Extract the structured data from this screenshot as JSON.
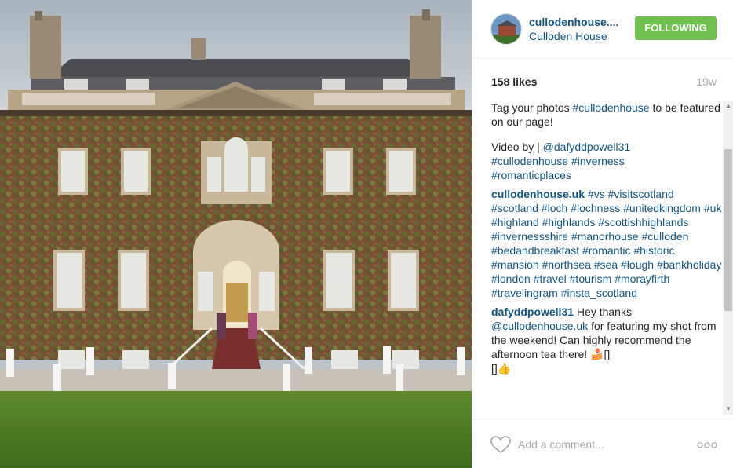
{
  "post": {
    "username": "cullodenhouse....",
    "location": "Culloden House",
    "follow_label": "FOLLOWING",
    "likes": "158 likes",
    "time_ago": "19w"
  },
  "caption": {
    "line1_text": "Tag your photos ",
    "line1_tag": "#cullodenhouse",
    "line1_rest": " to be featured on our page!",
    "video_prefix": "Video by | ",
    "video_mention": "@dafyddpowell31",
    "tag_cullodenhouse": "#cullodenhouse",
    "tag_inverness": "#inverness",
    "tag_romanticplaces": "#romanticplaces"
  },
  "comments": [
    {
      "author": "cullodenhouse.uk",
      "tags": [
        "#vs",
        "#visitscotland",
        "#scotland",
        "#loch",
        "#lochness",
        "#unitedkingdom",
        "#uk",
        "#highland",
        "#highlands",
        "#scottishhighlands",
        "#invernessshire",
        "#manorhouse",
        "#culloden",
        "#bedandbreakfast",
        "#romantic",
        "#historic",
        "#mansion",
        "#northsea",
        "#sea",
        "#lough",
        "#bankholiday",
        "#london",
        "#travel",
        "#tourism",
        "#morayfirth",
        "#travelingram",
        "#insta_scotland"
      ]
    },
    {
      "author": "dafyddpowell31",
      "text_a": " Hey thanks ",
      "mention": "@cullodenhouse.uk",
      "text_b": " for featuring my shot from the weekend! Can highly recommend the afternoon tea there! ",
      "emoji": "🍰[]\n[]👍"
    }
  ],
  "footer": {
    "comment_placeholder": "Add a comment..."
  },
  "colors": {
    "link": "#125688",
    "follow_button": "#70c050",
    "muted": "#a5a7aa"
  },
  "icons": {
    "like": "heart-icon",
    "more": "more-options-icon",
    "avatar": "avatar",
    "scroll_up": "scroll-up-arrow-icon",
    "scroll_down": "scroll-down-arrow-icon"
  }
}
